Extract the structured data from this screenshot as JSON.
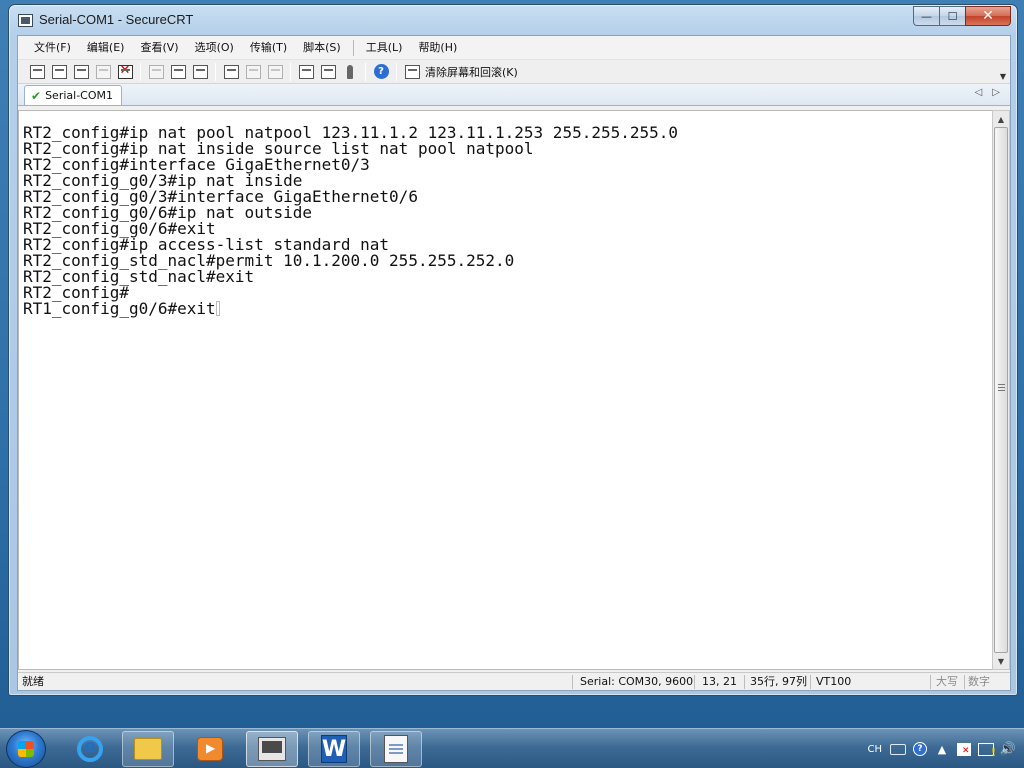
{
  "window": {
    "title": "Serial-COM1 - SecureCRT",
    "minimize_glyph": "—",
    "maximize_glyph": "☐",
    "close_glyph": "✕"
  },
  "menu": {
    "items": [
      "文件(F)",
      "编辑(E)",
      "查看(V)",
      "选项(O)",
      "传输(T)",
      "脚本(S)",
      "工具(L)",
      "帮助(H)"
    ]
  },
  "toolbar": {
    "icons": [
      "connect-icon",
      "quick-connect-icon",
      "connect-in-tab-icon",
      "reconnect-icon",
      "disconnect-icon",
      "copy-icon",
      "paste-icon",
      "find-icon",
      "print-icon",
      "print-selection-icon",
      "print-setup-icon",
      "session-options-icon",
      "global-options-icon",
      "keymap-icon",
      "help-icon",
      "clear-screen-icon"
    ],
    "clear_label": "清除屏幕和回滚(K)",
    "help_glyph": "?"
  },
  "tabs": [
    {
      "label": "Serial-COM1",
      "status": "connected",
      "status_glyph": "✔"
    }
  ],
  "tab_scroll": {
    "left_glyph": "◁",
    "right_glyph": "▷"
  },
  "terminal": {
    "lines": [
      "RT2_config#ip nat pool natpool 123.11.1.2 123.11.1.253 255.255.255.0",
      "RT2_config#ip nat inside source list nat pool natpool",
      "RT2_config#interface GigaEthernet0/3",
      "RT2_config_g0/3#ip nat inside",
      "RT2_config_g0/3#interface GigaEthernet0/6",
      "RT2_config_g0/6#ip nat outside",
      "RT2_config_g0/6#exit",
      "RT2_config#ip access-list standard nat",
      "RT2_config_std_nacl#permit 10.1.200.0 255.255.252.0",
      "RT2_config_std_nacl#exit",
      "RT2_config#",
      "RT1_config_g0/6#exit"
    ],
    "scroll_up_glyph": "▲",
    "scroll_down_glyph": "▼"
  },
  "statusbar": {
    "status": "就绪",
    "connection": "Serial: COM30, 9600",
    "cursor_pos": "13,  21",
    "size": "35行, 97列",
    "emulation": "VT100",
    "caps": "大写",
    "num": "数字"
  },
  "taskbar": {
    "apps": [
      "start-orb",
      "internet-explorer",
      "file-explorer",
      "media-player",
      "securecrt",
      "wps-writer",
      "document-viewer"
    ],
    "tray": {
      "lang": "CH",
      "help_glyph": "?",
      "up_arrow": "▲",
      "volume_glyph": "🔊"
    }
  },
  "colors": {
    "terminal_bg": "#ffffff",
    "terminal_fg": "#111111",
    "desktop": "#2d6fa8"
  }
}
